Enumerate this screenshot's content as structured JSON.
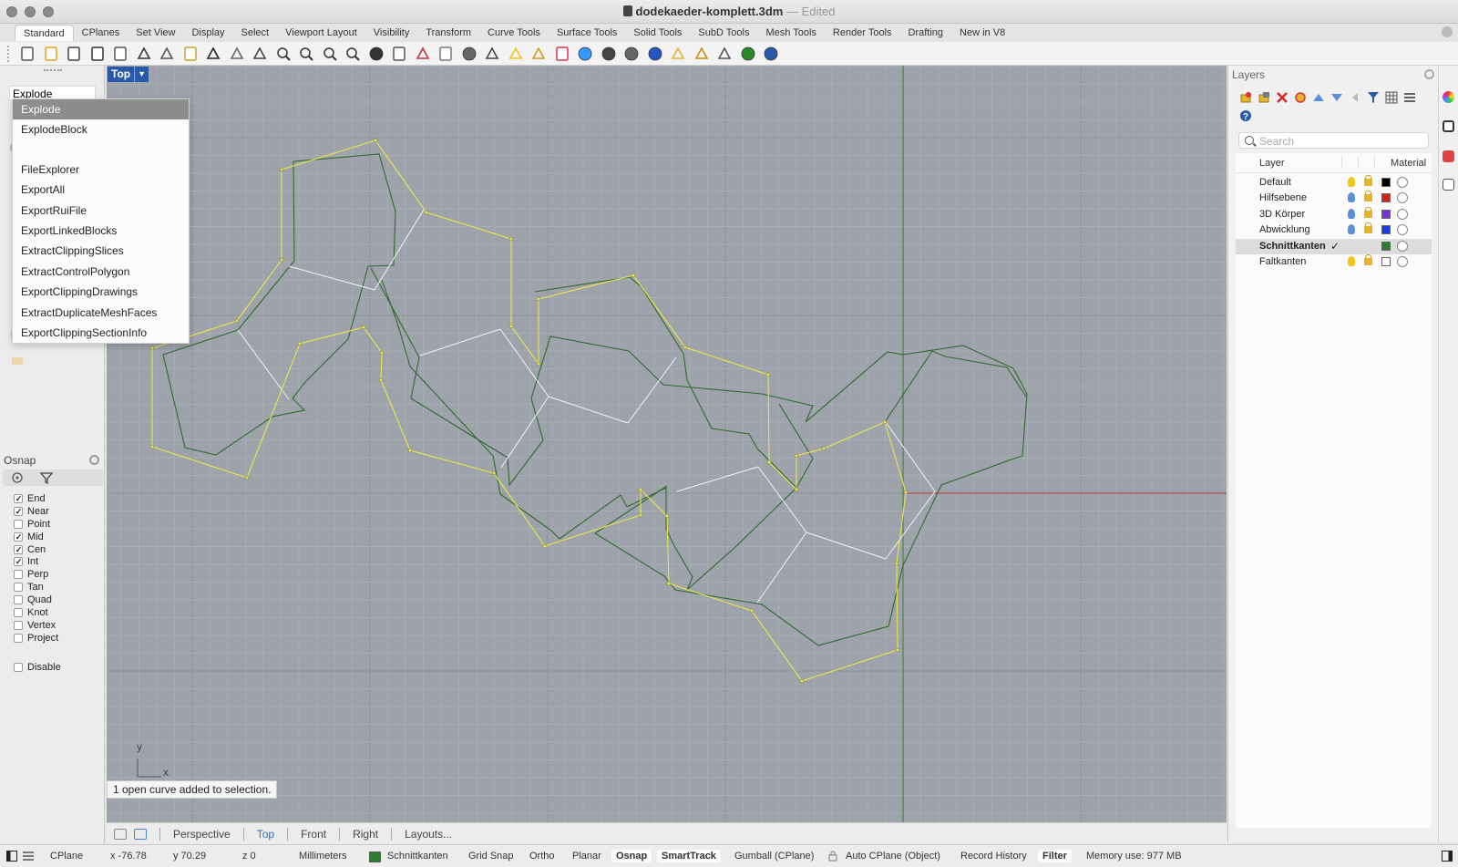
{
  "window": {
    "doc_title": "dodekaeder-komplett.3dm",
    "separator": "—",
    "status": "Edited"
  },
  "tabs": [
    "Standard",
    "CPlanes",
    "Set View",
    "Display",
    "Select",
    "Viewport Layout",
    "Visibility",
    "Transform",
    "Curve Tools",
    "Surface Tools",
    "Solid Tools",
    "SubD Tools",
    "Mesh Tools",
    "Render Tools",
    "Drafting",
    "New in V8"
  ],
  "active_tab": "Standard",
  "toolbar_icons": [
    "new-file-icon",
    "open-file-icon",
    "save-icon",
    "print-icon",
    "import-icon",
    "cut-icon",
    "copy-icon",
    "paste-icon",
    "undo-icon",
    "pan-hand-icon",
    "rotate-view-icon",
    "zoom-icon",
    "zoom-window-icon",
    "zoom-extents-icon",
    "zoom-selected-icon",
    "refresh-icon",
    "viewport-grid-icon",
    "car-icon",
    "cplane-icon",
    "snap-target-icon",
    "move-icon",
    "light-bulb-icon",
    "lock-icon",
    "layer-icon",
    "color-wheel-icon",
    "sphere-wire-icon",
    "sphere-shaded-icon",
    "sphere-render-icon",
    "pencil-icon",
    "gear-settings-icon",
    "dimension-icon",
    "globe-icon",
    "help-icon"
  ],
  "command": {
    "input_value": "Explode",
    "autocomplete": [
      "Explode",
      "ExplodeBlock",
      "",
      "FileExplorer",
      "ExportAll",
      "ExportRuiFile",
      "ExportLinkedBlocks",
      "ExtractClippingSlices",
      "ExtractControlPolygon",
      "ExportClippingDrawings",
      "ExtractDuplicateMeshFaces",
      "ExportClippingSectionInfo"
    ],
    "selected_index": 0
  },
  "osnap": {
    "title": "Osnap",
    "items": [
      {
        "label": "End",
        "checked": true
      },
      {
        "label": "Near",
        "checked": true
      },
      {
        "label": "Point",
        "checked": false
      },
      {
        "label": "Mid",
        "checked": true
      },
      {
        "label": "Cen",
        "checked": true
      },
      {
        "label": "Int",
        "checked": true
      },
      {
        "label": "Perp",
        "checked": false
      },
      {
        "label": "Tan",
        "checked": false
      },
      {
        "label": "Quad",
        "checked": false
      },
      {
        "label": "Knot",
        "checked": false
      },
      {
        "label": "Vertex",
        "checked": false
      },
      {
        "label": "Project",
        "checked": false
      }
    ],
    "disable_label": "Disable",
    "disable_checked": false
  },
  "viewport": {
    "name": "Top",
    "axis_x": "x",
    "axis_y": "y",
    "status_message": "1 open curve added to selection.",
    "colors": {
      "background": "#9ea2aa",
      "grid_minor": "#a8acb3",
      "grid_major": "#8f939a",
      "axis_x": "#b33a3a",
      "axis_y": "#3f7a3f",
      "selected_curve": "#e8e84a",
      "layer_curve": "#2e6a2e",
      "fold_edge": "#f4f4f4"
    }
  },
  "view_tabs": [
    "Perspective",
    "Top",
    "Front",
    "Right",
    "Layouts..."
  ],
  "active_view_tab": "Top",
  "layers": {
    "title": "Layers",
    "search_placeholder": "Search",
    "col_layer": "Layer",
    "col_material": "Material",
    "rows": [
      {
        "name": "Default",
        "color": "#000000",
        "bulb": "yellow",
        "current": false
      },
      {
        "name": "Hilfsebene",
        "color": "#cc2222",
        "bulb": "blue",
        "current": false
      },
      {
        "name": "3D Körper",
        "color": "#7b2fd0",
        "bulb": "blue",
        "current": false
      },
      {
        "name": "Abwicklung",
        "color": "#1c3de0",
        "bulb": "blue",
        "current": false
      },
      {
        "name": "Schnittkanten",
        "color": "#2e7d32",
        "bulb": "none",
        "current": true
      },
      {
        "name": "Faltkanten",
        "color": "#ffffff",
        "bulb": "yellow",
        "current": false
      }
    ],
    "current_mark": "✓"
  },
  "statusbar": {
    "cplane": "CPlane",
    "x": "x -76.78",
    "y": "y 70.29",
    "z": "z 0",
    "units": "Millimeters",
    "layer": "Schnittkanten",
    "grid_snap": "Grid Snap",
    "ortho": "Ortho",
    "planar": "Planar",
    "osnap": "Osnap",
    "smarttrack": "SmartTrack",
    "gumball": "Gumball (CPlane)",
    "auto_cplane": "Auto CPlane (Object)",
    "record_history": "Record History",
    "filter": "Filter",
    "memory": "Memory use: 977 MB"
  }
}
